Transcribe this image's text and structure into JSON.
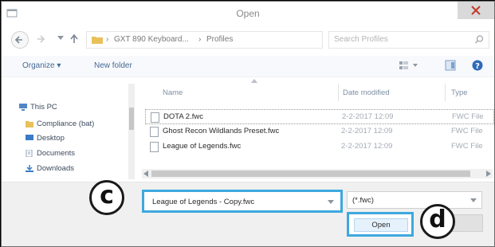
{
  "window": {
    "title": "Open"
  },
  "address_bar": {
    "path": [
      "GXT 890 Keyboard...",
      "Profiles"
    ],
    "separator": "›"
  },
  "search": {
    "placeholder": "Search Profiles"
  },
  "toolbar": {
    "organize_label": "Organize ▾",
    "new_folder_label": "New folder"
  },
  "nav_pane": {
    "items": [
      {
        "label": "This PC",
        "icon": "computer-icon"
      },
      {
        "label": "Compliance (bat)",
        "icon": "folder-icon"
      },
      {
        "label": "Desktop",
        "icon": "desktop-icon"
      },
      {
        "label": "Documents",
        "icon": "documents-icon"
      },
      {
        "label": "Downloads",
        "icon": "downloads-icon"
      }
    ]
  },
  "file_list": {
    "columns": [
      "Name",
      "Date modified",
      "Type"
    ],
    "rows": [
      {
        "name": "DOTA 2.fwc",
        "date": "2-2-2017 12:09",
        "type": "FWC File"
      },
      {
        "name": "Ghost Recon Wildlands Preset.fwc",
        "date": "2-2-2017 12:09",
        "type": "FWC File"
      },
      {
        "name": "League of Legends.fwc",
        "date": "2-2-2017 12:09",
        "type": "FWC File"
      }
    ]
  },
  "file_name": {
    "value": "League of Legends - Copy.fwc"
  },
  "file_type": {
    "value": "(*.fwc)"
  },
  "buttons": {
    "open_label": "Open"
  },
  "callouts": {
    "c": "c",
    "d": "d"
  },
  "colors": {
    "highlight": "#3ea8df",
    "link": "#456a94",
    "close_bg": "#d9d9d9"
  }
}
